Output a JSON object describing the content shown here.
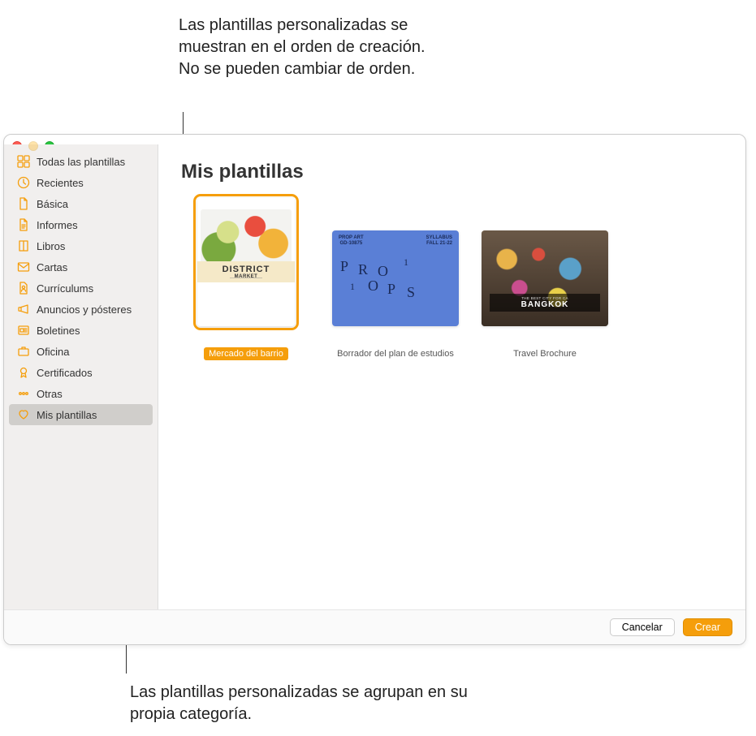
{
  "callouts": {
    "top": "Las plantillas personalizadas se muestran en el orden de creación. No se pueden cambiar de orden.",
    "bottom": "Las plantillas personalizadas se agrupan en su propia categoría."
  },
  "sidebar": {
    "items": [
      {
        "label": "Todas las plantillas",
        "icon": "grid",
        "color": "#f59e0b"
      },
      {
        "label": "Recientes",
        "icon": "clock",
        "color": "#f59e0b"
      },
      {
        "label": "Básica",
        "icon": "doc",
        "color": "#f59e0b"
      },
      {
        "label": "Informes",
        "icon": "doc-text",
        "color": "#f59e0b"
      },
      {
        "label": "Libros",
        "icon": "book",
        "color": "#f59e0b"
      },
      {
        "label": "Cartas",
        "icon": "envelope",
        "color": "#f59e0b"
      },
      {
        "label": "Currículums",
        "icon": "person-doc",
        "color": "#f59e0b"
      },
      {
        "label": "Anuncios y pósteres",
        "icon": "megaphone",
        "color": "#f59e0b"
      },
      {
        "label": "Boletines",
        "icon": "news",
        "color": "#f59e0b"
      },
      {
        "label": "Oficina",
        "icon": "briefcase",
        "color": "#f59e0b"
      },
      {
        "label": "Certificados",
        "icon": "ribbon",
        "color": "#f59e0b"
      },
      {
        "label": "Otras",
        "icon": "ellipsis",
        "color": "#f59e0b"
      },
      {
        "label": "Mis plantillas",
        "icon": "heart",
        "color": "#f59e0b",
        "selected": true
      }
    ]
  },
  "content": {
    "heading": "Mis plantillas",
    "templates": [
      {
        "label": "Mercado del barrio",
        "selected": true,
        "orientation": "portrait",
        "thumb": {
          "kind": "district-market",
          "title": "DISTRICT",
          "subtitle": "MARKET"
        }
      },
      {
        "label": "Borrador del plan de estudios",
        "selected": false,
        "orientation": "landscape",
        "thumb": {
          "kind": "props",
          "header_left_line1": "PROP ART",
          "header_left_line2": "GD-10875",
          "header_right_line1": "SYLLABUS",
          "header_right_line2": "FALL 21-22",
          "word": "PROPS",
          "accent1": "1",
          "accent2": "1"
        }
      },
      {
        "label": "Travel Brochure",
        "selected": false,
        "orientation": "landscape",
        "thumb": {
          "kind": "bangkok",
          "tiny": "THE BEST CITY FOR CA",
          "title": "BANGKOK"
        }
      }
    ]
  },
  "footer": {
    "cancel": "Cancelar",
    "create": "Crear"
  }
}
